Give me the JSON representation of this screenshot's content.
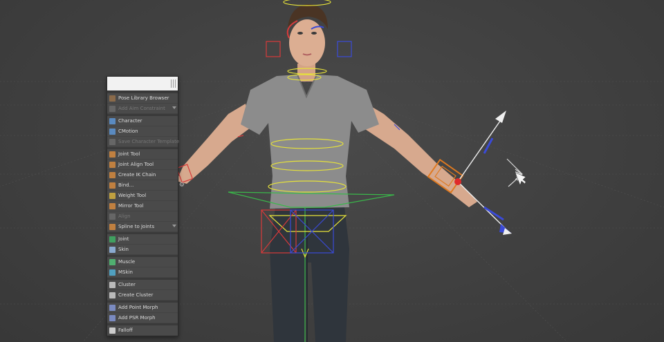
{
  "menu": {
    "search_placeholder": "",
    "groups": [
      [
        {
          "label": "Pose Library Browser",
          "icon": "pose-library-icon",
          "color": "#8a6a4a",
          "enabled": true
        },
        {
          "label": "Add Aim Constraint",
          "icon": "aim-constraint-icon",
          "color": "#666666",
          "enabled": false
        }
      ],
      [
        {
          "label": "Character",
          "icon": "character-icon",
          "color": "#5a8ac0",
          "enabled": true
        },
        {
          "label": "CMotion",
          "icon": "cmotion-icon",
          "color": "#5a8ac0",
          "enabled": true
        },
        {
          "label": "Save Character Template",
          "icon": "save-template-icon",
          "color": "#666666",
          "enabled": false
        }
      ],
      [
        {
          "label": "Joint Tool",
          "icon": "joint-tool-icon",
          "color": "#c08040",
          "enabled": true
        },
        {
          "label": "Joint Align Tool",
          "icon": "joint-align-icon",
          "color": "#c08040",
          "enabled": true
        },
        {
          "label": "Create IK Chain",
          "icon": "ik-chain-icon",
          "color": "#c08040",
          "enabled": true
        },
        {
          "label": "Bind...",
          "icon": "bind-icon",
          "color": "#c08040",
          "enabled": true,
          "gear": true
        },
        {
          "label": "Weight Tool",
          "icon": "weight-tool-icon",
          "color": "#c0a040",
          "enabled": true
        },
        {
          "label": "Mirror Tool",
          "icon": "mirror-tool-icon",
          "color": "#c08040",
          "enabled": true
        },
        {
          "label": "Align",
          "icon": "align-icon",
          "color": "#666666",
          "enabled": false
        },
        {
          "label": "Spline to Joints",
          "icon": "spline-joints-icon",
          "color": "#c08040",
          "enabled": true
        }
      ],
      [
        {
          "label": "Joint",
          "icon": "joint-icon",
          "color": "#40a060",
          "enabled": true
        },
        {
          "label": "Skin",
          "icon": "skin-icon",
          "color": "#8aaad0",
          "enabled": true
        }
      ],
      [
        {
          "label": "Muscle",
          "icon": "muscle-icon",
          "color": "#50b070",
          "enabled": true
        },
        {
          "label": "MSkin",
          "icon": "mskin-icon",
          "color": "#50a0c0",
          "enabled": true
        }
      ],
      [
        {
          "label": "Cluster",
          "icon": "cluster-icon",
          "color": "#bbbbbb",
          "enabled": true
        },
        {
          "label": "Create Cluster",
          "icon": "create-cluster-icon",
          "color": "#bbbbbb",
          "enabled": true
        }
      ],
      [
        {
          "label": "Add Point Morph",
          "icon": "point-morph-icon",
          "color": "#7a8ac0",
          "enabled": true
        },
        {
          "label": "Add PSR Morph",
          "icon": "psr-morph-icon",
          "color": "#7a8ac0",
          "enabled": true
        }
      ],
      [
        {
          "label": "Falloff",
          "icon": "falloff-icon",
          "color": "#cccccc",
          "enabled": true
        }
      ]
    ]
  },
  "colors": {
    "viewport_bg": "#404040",
    "rig_yellow": "#e6e23a",
    "rig_green": "#3ab84a",
    "rig_red": "#d83a3a",
    "rig_blue": "#3a4ad8",
    "rig_orange": "#e07a20",
    "manipulator_white": "#f0f0f0"
  }
}
